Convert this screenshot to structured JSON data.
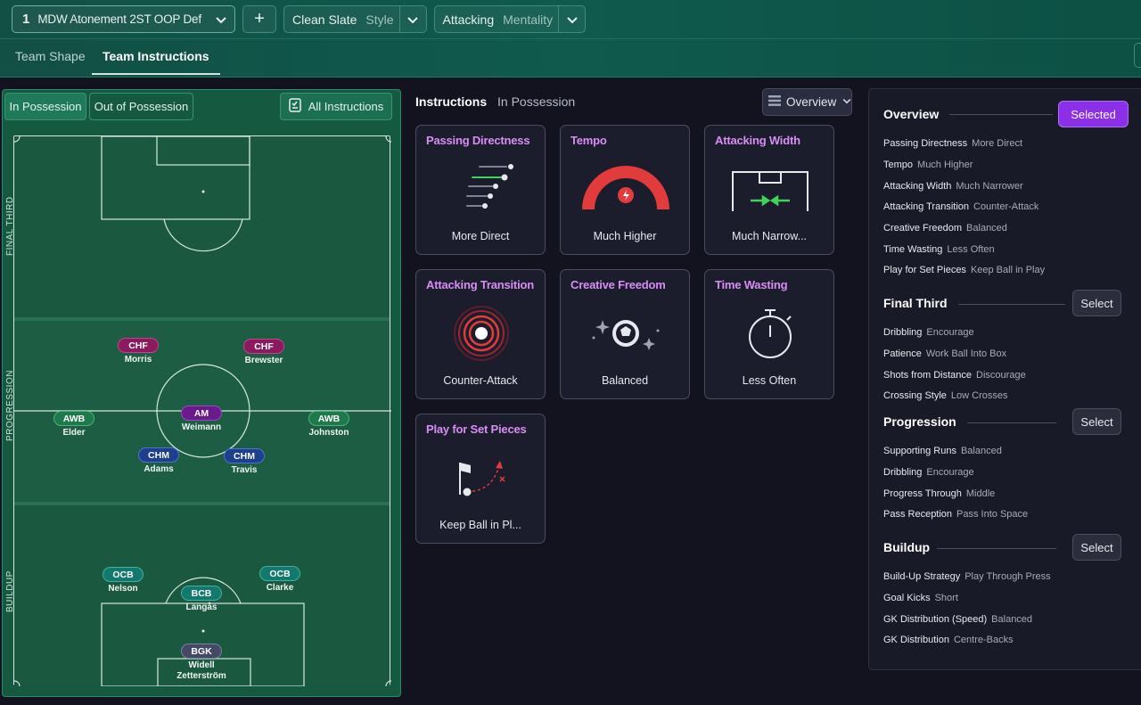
{
  "header": {
    "tactic_number": "1",
    "tactic_name": "MDW Atonement 2ST OOP Def",
    "add_label": "+",
    "style_key": "Clean Slate",
    "style_val": "Style",
    "mentality_key": "Attacking",
    "mentality_val": "Mentality"
  },
  "tabs": {
    "shape": "Team Shape",
    "instructions": "Team Instructions"
  },
  "pitch_panel": {
    "in_possession": "In Possession",
    "out_of_possession": "Out of Possession",
    "all_instructions": "All Instructions",
    "zones": {
      "final": "FINAL THIRD",
      "progression": "PROGRESSION",
      "buildup": "BUILDUP"
    },
    "players": [
      {
        "role": "CHF",
        "name": "Morris"
      },
      {
        "role": "CHF",
        "name": "Brewster"
      },
      {
        "role": "AWB",
        "name": "Elder"
      },
      {
        "role": "AM",
        "name": "Weimann"
      },
      {
        "role": "AWB",
        "name": "Johnston"
      },
      {
        "role": "CHM",
        "name": "Adams"
      },
      {
        "role": "CHM",
        "name": "Travis"
      },
      {
        "role": "OCB",
        "name": "Nelson"
      },
      {
        "role": "OCB",
        "name": "Clarke"
      },
      {
        "role": "BCB",
        "name": "Langås"
      },
      {
        "role": "BGK",
        "name": "Widell Zetterström"
      }
    ]
  },
  "instructions": {
    "title": "Instructions",
    "subtitle": "In Possession",
    "view_dropdown": "Overview",
    "cards": [
      {
        "title": "Passing Directness",
        "value": "More Direct"
      },
      {
        "title": "Tempo",
        "value": "Much Higher"
      },
      {
        "title": "Attacking Width",
        "value": "Much Narrow..."
      },
      {
        "title": "Attacking Transition",
        "value": "Counter-Attack"
      },
      {
        "title": "Creative Freedom",
        "value": "Balanced"
      },
      {
        "title": "Time Wasting",
        "value": "Less Often"
      },
      {
        "title": "Play for Set Pieces",
        "value": "Keep Ball in Pl..."
      }
    ]
  },
  "overview": {
    "title": "Overview",
    "selected_label": "Selected",
    "select_label": "Select",
    "overview_rows": [
      {
        "k": "Passing Directness",
        "v": "More Direct"
      },
      {
        "k": "Tempo",
        "v": "Much Higher"
      },
      {
        "k": "Attacking Width",
        "v": "Much Narrower"
      },
      {
        "k": "Attacking Transition",
        "v": "Counter-Attack"
      },
      {
        "k": "Creative Freedom",
        "v": "Balanced"
      },
      {
        "k": "Time Wasting",
        "v": "Less Often"
      },
      {
        "k": "Play for Set Pieces",
        "v": "Keep Ball in Play"
      }
    ],
    "final_third_title": "Final Third",
    "final_third_rows": [
      {
        "k": "Dribbling",
        "v": "Encourage"
      },
      {
        "k": "Patience",
        "v": "Work Ball Into Box"
      },
      {
        "k": "Shots from Distance",
        "v": "Discourage"
      },
      {
        "k": "Crossing Style",
        "v": "Low Crosses"
      }
    ],
    "progression_title": "Progression",
    "progression_rows": [
      {
        "k": "Supporting Runs",
        "v": "Balanced"
      },
      {
        "k": "Dribbling",
        "v": "Encourage"
      },
      {
        "k": "Progress Through",
        "v": "Middle"
      },
      {
        "k": "Pass Reception",
        "v": "Pass Into Space"
      }
    ],
    "buildup_title": "Buildup",
    "buildup_rows": [
      {
        "k": "Build-Up Strategy",
        "v": "Play Through Press"
      },
      {
        "k": "Goal Kicks",
        "v": "Short"
      },
      {
        "k": "GK Distribution (Speed)",
        "v": "Balanced"
      },
      {
        "k": "GK Distribution",
        "v": "Centre-Backs"
      }
    ]
  },
  "colors": {
    "accent_purple": "#8b2fe8",
    "card_title": "#d98cf5",
    "pitch_green": "#1a5840"
  }
}
